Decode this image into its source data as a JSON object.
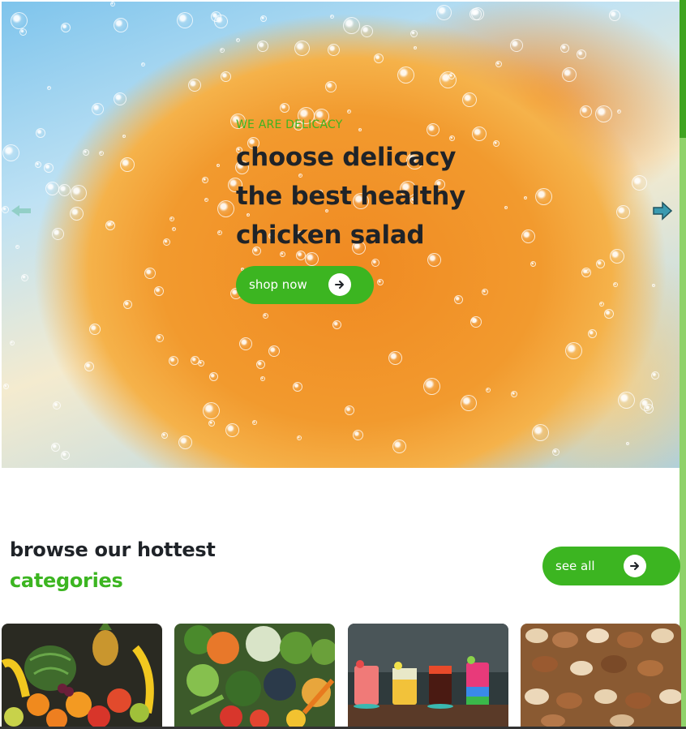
{
  "hero": {
    "subtitle": "WE ARE DELICACY",
    "title_lines": [
      "choose delicacy",
      "the best healthy",
      "chicken salad"
    ],
    "cta_label": "shop now"
  },
  "categories_section": {
    "title_line1": "browse our hottest",
    "title_line2": "categories",
    "see_all_label": "see all"
  },
  "categories": [
    {
      "image": "fruits"
    },
    {
      "image": "vegetables"
    },
    {
      "image": "cocktails"
    },
    {
      "image": "nuts"
    }
  ],
  "colors": {
    "accent_green": "#3cb521",
    "heading_dark": "#1f2328",
    "arrow_teal": "#3a9ab0"
  },
  "icons": {
    "cta_arrow": "arrow-right-circle-icon",
    "slider_prev": "arrow-left-icon",
    "slider_next": "arrow-right-icon"
  }
}
